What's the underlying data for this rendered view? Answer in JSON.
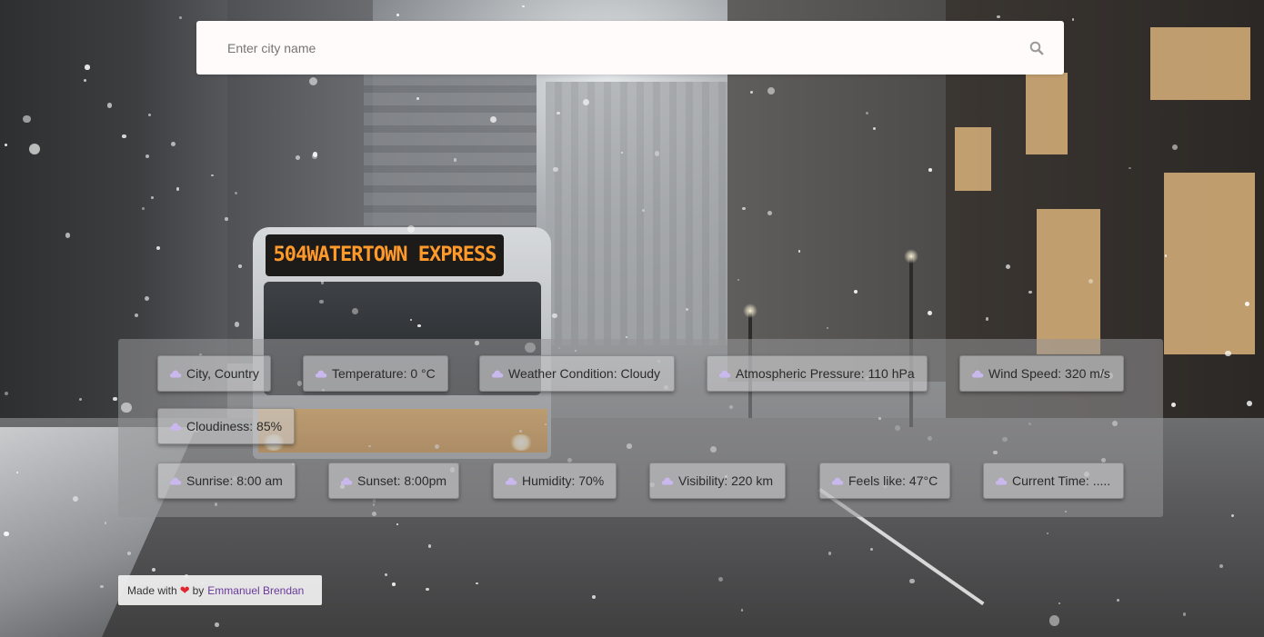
{
  "search": {
    "placeholder": "Enter city name",
    "value": ""
  },
  "bus_sign": "504WATERTOWN EXPRESS",
  "weather": {
    "row1": [
      {
        "label": "City, Country"
      },
      {
        "label": "Temperature: 0 °C"
      },
      {
        "label": "Weather Condition: Cloudy"
      },
      {
        "label": "Atmospheric Pressure: 110 hPa"
      },
      {
        "label": "Wind Speed: 320 m/s"
      },
      {
        "label": "Cloudiness: 85%"
      }
    ],
    "row2": [
      {
        "label": "Sunrise: 8:00 am"
      },
      {
        "label": "Sunset: 8:00pm"
      },
      {
        "label": "Humidity: 70%"
      },
      {
        "label": "Visibility: 220 km"
      },
      {
        "label": "Feels like: 47°C"
      },
      {
        "label": "Current Time: ....."
      }
    ],
    "icon": "cloud-icon",
    "icon_color": "#c9b8ee"
  },
  "footer": {
    "made_with": "Made with",
    "by": "by",
    "author": "Emmanuel Brendan",
    "heart_icon": "heart-icon",
    "heart_color": "#e0262f",
    "author_color": "#6a3a9a"
  }
}
